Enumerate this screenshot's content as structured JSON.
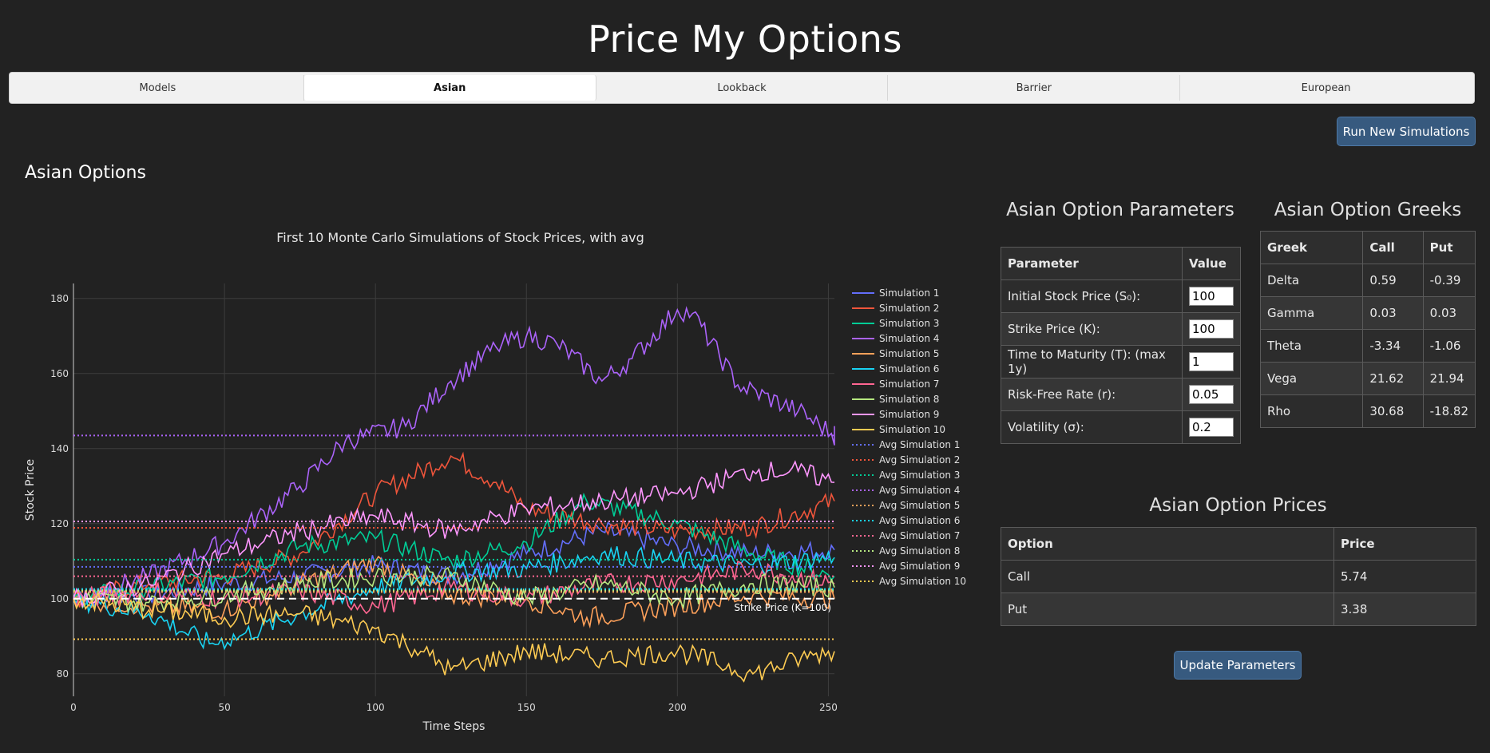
{
  "app": {
    "title": "Price My Options"
  },
  "tabs": [
    {
      "label": "Models",
      "active": false
    },
    {
      "label": "Asian",
      "active": true
    },
    {
      "label": "Lookback",
      "active": false
    },
    {
      "label": "Barrier",
      "active": false
    },
    {
      "label": "European",
      "active": false
    }
  ],
  "actions": {
    "run_label": "Run New Simulations",
    "update_label": "Update Parameters"
  },
  "section": {
    "title": "Asian Options"
  },
  "parameters": {
    "title": "Asian Option Parameters",
    "headers": [
      "Parameter",
      "Value"
    ],
    "rows": [
      {
        "label": "Initial Stock Price (S₀):",
        "value": "100"
      },
      {
        "label": "Strike Price (K):",
        "value": "100"
      },
      {
        "label": "Time to Maturity (T): (max 1y)",
        "value": "1"
      },
      {
        "label": "Risk-Free Rate (r):",
        "value": "0.05"
      },
      {
        "label": "Volatility (σ):",
        "value": "0.2"
      }
    ]
  },
  "greeks": {
    "title": "Asian Option Greeks",
    "headers": [
      "Greek",
      "Call",
      "Put"
    ],
    "rows": [
      [
        "Delta",
        "0.59",
        "-0.39"
      ],
      [
        "Gamma",
        "0.03",
        "0.03"
      ],
      [
        "Theta",
        "-3.34",
        "-1.06"
      ],
      [
        "Vega",
        "21.62",
        "21.94"
      ],
      [
        "Rho",
        "30.68",
        "-18.82"
      ]
    ]
  },
  "prices": {
    "title": "Asian Option Prices",
    "headers": [
      "Option",
      "Price"
    ],
    "rows": [
      [
        "Call",
        "5.74"
      ],
      [
        "Put",
        "3.38"
      ]
    ]
  },
  "chart_data": {
    "type": "line",
    "title": "First 10 Monte Carlo Simulations of Stock Prices, with avg",
    "xlabel": "Time Steps",
    "ylabel": "Stock Price",
    "xlim": [
      0,
      252
    ],
    "ylim": [
      74,
      184
    ],
    "x_ticks": [
      0,
      50,
      100,
      150,
      200,
      250
    ],
    "y_ticks": [
      80,
      100,
      120,
      140,
      160,
      180
    ],
    "grid": true,
    "legend_position": "right",
    "strike": {
      "value": 100,
      "label": "Strike Price (K=100)"
    },
    "series": [
      {
        "name": "Simulation 1",
        "color": "#636efa",
        "points": [
          [
            0,
            100
          ],
          [
            25,
            101
          ],
          [
            50,
            104
          ],
          [
            75,
            106
          ],
          [
            100,
            109
          ],
          [
            125,
            106
          ],
          [
            150,
            112
          ],
          [
            175,
            118
          ],
          [
            200,
            114
          ],
          [
            225,
            112
          ],
          [
            252,
            113
          ]
        ]
      },
      {
        "name": "Simulation 2",
        "color": "#ef553b",
        "points": [
          [
            0,
            100
          ],
          [
            25,
            104
          ],
          [
            50,
            106
          ],
          [
            75,
            112
          ],
          [
            100,
            128
          ],
          [
            125,
            138
          ],
          [
            140,
            131
          ],
          [
            150,
            124
          ],
          [
            175,
            120
          ],
          [
            200,
            118
          ],
          [
            225,
            119
          ],
          [
            252,
            126
          ]
        ]
      },
      {
        "name": "Simulation 3",
        "color": "#00cc96",
        "points": [
          [
            0,
            100
          ],
          [
            25,
            103
          ],
          [
            50,
            106
          ],
          [
            75,
            114
          ],
          [
            100,
            116
          ],
          [
            125,
            110
          ],
          [
            150,
            115
          ],
          [
            170,
            126
          ],
          [
            200,
            120
          ],
          [
            225,
            112
          ],
          [
            252,
            106
          ]
        ]
      },
      {
        "name": "Simulation 4",
        "color": "#ab63fa",
        "points": [
          [
            0,
            100
          ],
          [
            25,
            106
          ],
          [
            50,
            115
          ],
          [
            75,
            130
          ],
          [
            90,
            142
          ],
          [
            110,
            146
          ],
          [
            125,
            158
          ],
          [
            140,
            167
          ],
          [
            150,
            170
          ],
          [
            160,
            168
          ],
          [
            175,
            158
          ],
          [
            185,
            164
          ],
          [
            200,
            177
          ],
          [
            205,
            176
          ],
          [
            220,
            157
          ],
          [
            240,
            150
          ],
          [
            255,
            142
          ],
          [
            252,
            146
          ]
        ]
      },
      {
        "name": "Simulation 5",
        "color": "#ffa15a",
        "points": [
          [
            0,
            100
          ],
          [
            25,
            98
          ],
          [
            50,
            97
          ],
          [
            75,
            104
          ],
          [
            100,
            110
          ],
          [
            115,
            104
          ],
          [
            125,
            101
          ],
          [
            150,
            100
          ],
          [
            170,
            95
          ],
          [
            200,
            98
          ],
          [
            225,
            101
          ],
          [
            252,
            100
          ]
        ]
      },
      {
        "name": "Simulation 6",
        "color": "#19d3f3",
        "points": [
          [
            0,
            100
          ],
          [
            25,
            96
          ],
          [
            45,
            88
          ],
          [
            55,
            90
          ],
          [
            75,
            96
          ],
          [
            100,
            103
          ],
          [
            125,
            107
          ],
          [
            150,
            108
          ],
          [
            175,
            112
          ],
          [
            200,
            110
          ],
          [
            225,
            109
          ],
          [
            252,
            111
          ]
        ]
      },
      {
        "name": "Simulation 7",
        "color": "#ff6692",
        "points": [
          [
            0,
            100
          ],
          [
            25,
            102
          ],
          [
            50,
            100
          ],
          [
            75,
            102
          ],
          [
            100,
            98
          ],
          [
            125,
            103
          ],
          [
            150,
            100
          ],
          [
            175,
            104
          ],
          [
            200,
            105
          ],
          [
            225,
            108
          ],
          [
            252,
            104
          ]
        ]
      },
      {
        "name": "Simulation 8",
        "color": "#b6e880",
        "points": [
          [
            0,
            100
          ],
          [
            25,
            99
          ],
          [
            50,
            101
          ],
          [
            75,
            104
          ],
          [
            100,
            106
          ],
          [
            125,
            106
          ],
          [
            150,
            100
          ],
          [
            175,
            104
          ],
          [
            200,
            100
          ],
          [
            225,
            104
          ],
          [
            252,
            103
          ]
        ]
      },
      {
        "name": "Simulation 9",
        "color": "#ff97ff",
        "points": [
          [
            0,
            100
          ],
          [
            25,
            104
          ],
          [
            50,
            112
          ],
          [
            75,
            118
          ],
          [
            100,
            122
          ],
          [
            125,
            118
          ],
          [
            150,
            124
          ],
          [
            175,
            126
          ],
          [
            200,
            128
          ],
          [
            225,
            134
          ],
          [
            240,
            134
          ],
          [
            252,
            131
          ]
        ]
      },
      {
        "name": "Simulation 10",
        "color": "#fecb52",
        "points": [
          [
            0,
            100
          ],
          [
            25,
            97
          ],
          [
            50,
            95
          ],
          [
            75,
            96
          ],
          [
            100,
            92
          ],
          [
            115,
            86
          ],
          [
            125,
            81
          ],
          [
            150,
            86
          ],
          [
            175,
            84
          ],
          [
            200,
            86
          ],
          [
            225,
            80
          ],
          [
            245,
            85
          ],
          [
            252,
            86
          ]
        ]
      }
    ],
    "averages": [
      {
        "name": "Avg Simulation 1",
        "color": "#636efa",
        "value": 108.5
      },
      {
        "name": "Avg Simulation 2",
        "color": "#ef553b",
        "value": 118.9
      },
      {
        "name": "Avg Simulation 3",
        "color": "#00cc96",
        "value": 110.4
      },
      {
        "name": "Avg Simulation 4",
        "color": "#ab63fa",
        "value": 143.5
      },
      {
        "name": "Avg Simulation 5",
        "color": "#ffa15a",
        "value": 101.8
      },
      {
        "name": "Avg Simulation 6",
        "color": "#19d3f3",
        "value": 102.6
      },
      {
        "name": "Avg Simulation 7",
        "color": "#ff6692",
        "value": 106.0
      },
      {
        "name": "Avg Simulation 8",
        "color": "#b6e880",
        "value": 102.2
      },
      {
        "name": "Avg Simulation 9",
        "color": "#ff97ff",
        "value": 120.6
      },
      {
        "name": "Avg Simulation 10",
        "color": "#fecb52",
        "value": 89.2
      }
    ]
  }
}
